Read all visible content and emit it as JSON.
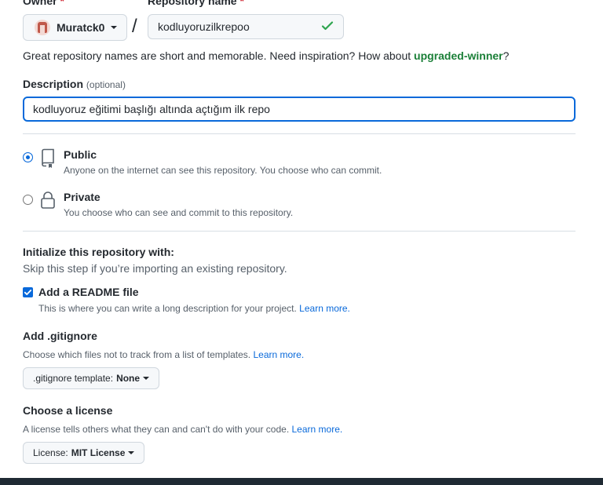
{
  "owner": {
    "label": "Owner",
    "required_mark": "*",
    "value": "Muratck0"
  },
  "repository": {
    "label": "Repository name",
    "required_mark": "*",
    "value": "kodluyoruzilkrepoo",
    "separator": "/"
  },
  "hint": {
    "text": "Great repository names are short and memorable. Need inspiration? How about ",
    "suggestion": "upgraded-winner",
    "suffix": "?"
  },
  "description": {
    "label": "Description",
    "optional": "(optional)",
    "value": "kodluyoruz eğitimi başlığı altında açtığım ilk repo"
  },
  "visibility": {
    "public": {
      "title": "Public",
      "desc": "Anyone on the internet can see this repository. You choose who can commit.",
      "selected": true
    },
    "private": {
      "title": "Private",
      "desc": "You choose who can see and commit to this repository.",
      "selected": false
    }
  },
  "initialize": {
    "title": "Initialize this repository with:",
    "subtitle": "Skip this step if you’re importing an existing repository.",
    "readme": {
      "label": "Add a README file",
      "desc": "This is where you can write a long description for your project.",
      "link": "Learn more.",
      "checked": true
    }
  },
  "gitignore": {
    "title": "Add .gitignore",
    "desc": "Choose which files not to track from a list of templates.",
    "link": "Learn more.",
    "button_prefix": ".gitignore template:",
    "button_value": "None"
  },
  "license": {
    "title": "Choose a license",
    "desc": "A license tells others what they can and can't do with your code.",
    "link": "Learn more.",
    "button_prefix": "License:",
    "button_value": "MIT License"
  },
  "colors": {
    "accent": "#0969da",
    "success": "#1a7f37",
    "danger": "#cf222e"
  }
}
